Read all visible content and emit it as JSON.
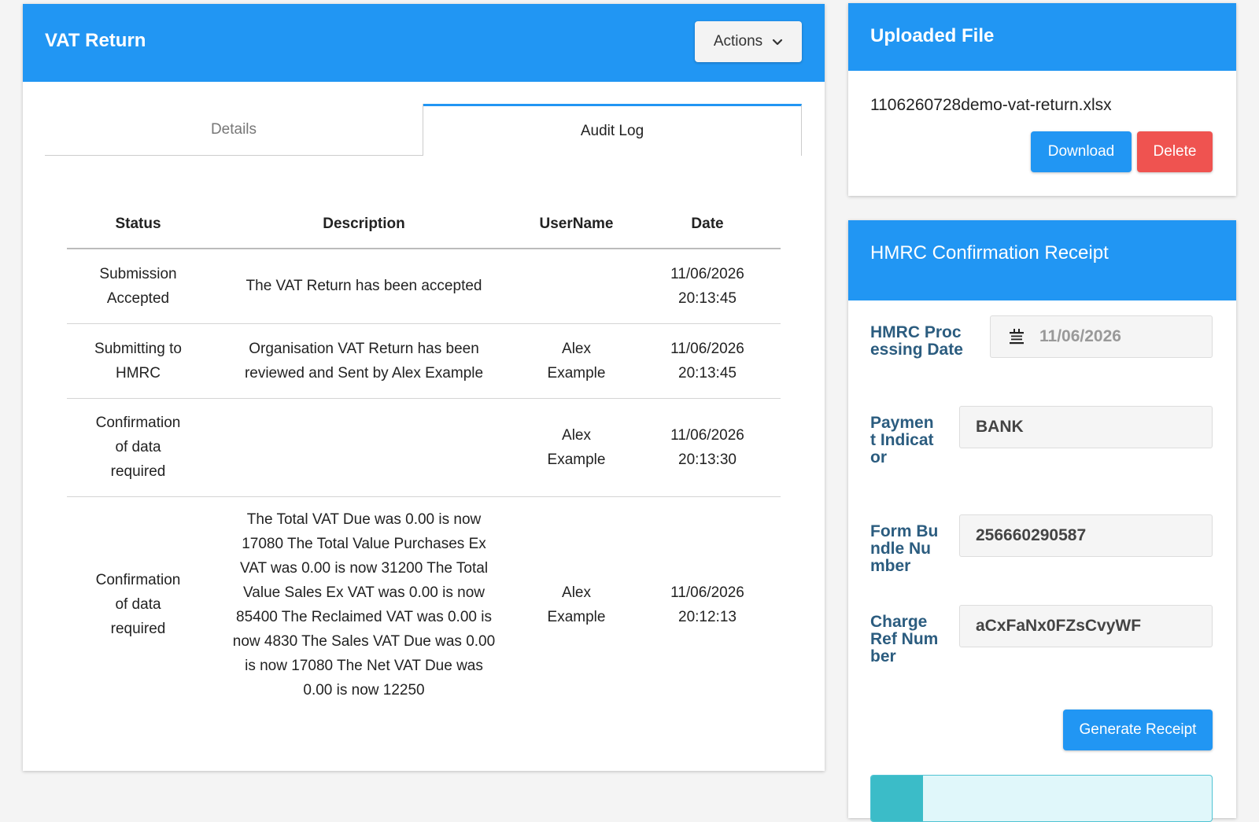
{
  "main": {
    "title": "VAT Return",
    "actions_label": "Actions",
    "tabs": [
      {
        "label": "Details",
        "active": false
      },
      {
        "label": "Audit Log",
        "active": true
      }
    ],
    "table": {
      "headers": [
        "Status",
        "Description",
        "UserName",
        "Date"
      ],
      "rows": [
        {
          "status": [
            "Submission",
            "Accepted"
          ],
          "description": [
            "The VAT Return has been accepted"
          ],
          "user": [],
          "date": [
            "11/06/2026",
            "20:13:45"
          ]
        },
        {
          "status": [
            "Submitting to",
            "HMRC"
          ],
          "description": [
            "Organisation VAT Return has been",
            "reviewed and Sent by Alex Example"
          ],
          "user": [
            "Alex",
            "Example"
          ],
          "date": [
            "11/06/2026",
            "20:13:45"
          ]
        },
        {
          "status": [
            "Confirmation",
            "of data",
            "required"
          ],
          "description": [],
          "user": [
            "Alex",
            "Example"
          ],
          "date": [
            "11/06/2026",
            "20:13:30"
          ]
        },
        {
          "status": [
            "Confirmation",
            "of data",
            "required"
          ],
          "description": [
            "The Total VAT Due was 0.00 is now",
            "17080 The Total Value Purchases Ex",
            "VAT was 0.00 is now 31200 The Total",
            "Value Sales Ex VAT was 0.00 is now",
            "85400 The Reclaimed VAT was 0.00 is",
            "now 4830 The Sales VAT Due was 0.00",
            "is now 17080 The Net VAT Due was",
            "0.00 is now 12250"
          ],
          "user": [
            "Alex",
            "Example"
          ],
          "date": [
            "11/06/2026",
            "20:12:13"
          ]
        }
      ]
    }
  },
  "uploaded": {
    "title": "Uploaded File",
    "file_name": "1106260728demo-vat-return.xlsx",
    "download_label": "Download",
    "delete_label": "Delete"
  },
  "hmrc": {
    "title": "HMRC Confirmation Receipt",
    "fields": [
      {
        "label": "HMRC Processing Date",
        "value": "11/06/2026",
        "icon": "calendar-icon"
      },
      {
        "label": "Payment Indicator",
        "value": "BANK"
      },
      {
        "label": "Form Bundle Number",
        "value": "256660290587"
      },
      {
        "label": "Charge Ref Number",
        "value": "aCxFaNx0FZsCvyWF"
      }
    ],
    "generate_label": "Generate Receipt"
  },
  "colors": {
    "primary": "#2196f3",
    "danger": "#ef5350",
    "label": "#2b5c7f",
    "info": "#3bbcc8"
  }
}
